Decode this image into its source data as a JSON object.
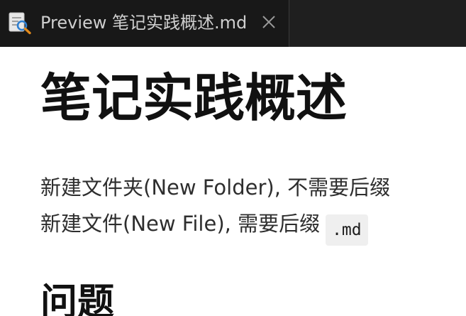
{
  "tab": {
    "icon": "preview-icon",
    "title": "Preview 笔记实践概述.md",
    "close_icon": "close-icon"
  },
  "document": {
    "heading1": "笔记实践概述",
    "line1": "新建文件夹(New Folder), 不需要后缀",
    "line2_text": "新建文件(New File), 需要后缀",
    "line2_code": ".md",
    "heading2": "问题"
  }
}
